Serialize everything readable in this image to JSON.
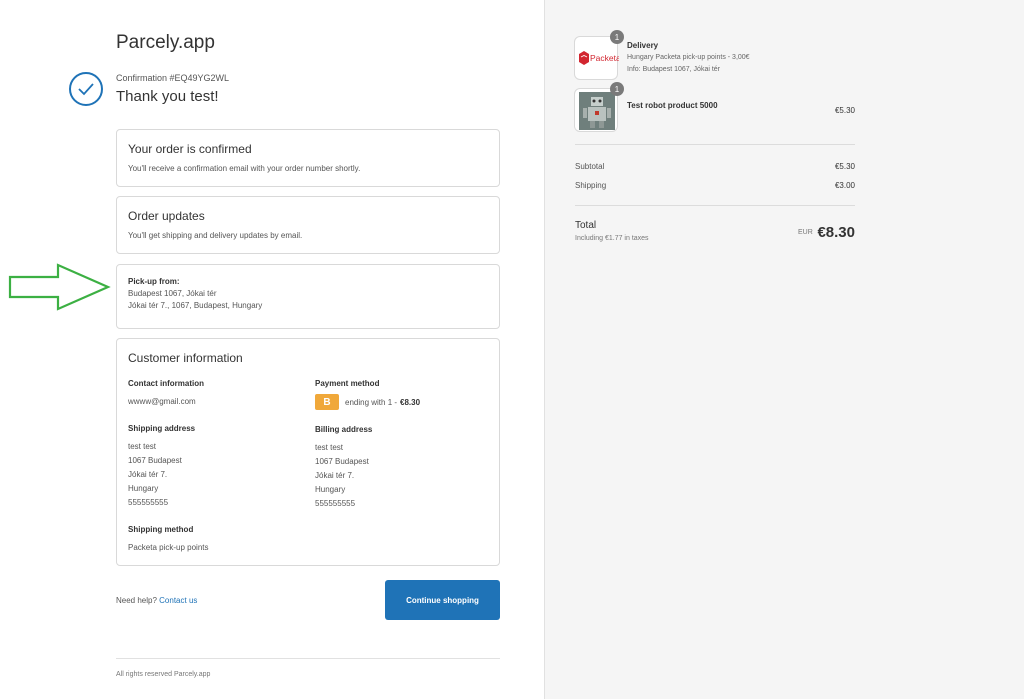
{
  "brand": "Parcely.app",
  "confirmation": {
    "number": "Confirmation #EQ49YG2WL",
    "thanks": "Thank you test!"
  },
  "order_confirmed": {
    "title": "Your order is confirmed",
    "text": "You'll receive a confirmation email with your order number shortly."
  },
  "order_updates": {
    "title": "Order updates",
    "text": "You'll get shipping and delivery updates by email."
  },
  "pickup": {
    "label": "Pick-up from:",
    "line1": "Budapest 1067, Jókai tér",
    "line2": "Jókai tér 7., 1067, Budapest, Hungary"
  },
  "customer": {
    "title": "Customer information",
    "contact_title": "Contact information",
    "contact_email": "wwww@gmail.com",
    "payment_title": "Payment method",
    "payment_badge": "B",
    "payment_text": "ending with 1 -",
    "payment_amount": "€8.30",
    "shipping_title": "Shipping address",
    "shipping_lines": [
      "test test",
      "1067 Budapest",
      "Jókai tér 7.",
      "Hungary",
      "555555555"
    ],
    "billing_title": "Billing address",
    "billing_lines": [
      "test test",
      "1067 Budapest",
      "Jókai tér 7.",
      "Hungary",
      "555555555"
    ],
    "method_title": "Shipping method",
    "method_text": "Packeta pick-up points"
  },
  "help": {
    "text": "Need help?",
    "link": "Contact us"
  },
  "continue_label": "Continue shopping",
  "footer": "All rights reserved Parcely.app",
  "summary": {
    "items": [
      {
        "qty": "1",
        "logo": "Packeta",
        "title": "Delivery",
        "sub1": "Hungary Packeta pick-up points - 3,00€",
        "sub2": "Info: Budapest 1067, Jókai tér",
        "price": ""
      },
      {
        "qty": "1",
        "title": "Test robot product 5000",
        "price": "€5.30"
      }
    ],
    "subtotal_label": "Subtotal",
    "subtotal_value": "€5.30",
    "shipping_label": "Shipping",
    "shipping_value": "€3.00",
    "total_label": "Total",
    "taxes": "Including €1.77 in taxes",
    "currency": "EUR",
    "total_value": "€8.30"
  },
  "colors": {
    "accent": "#1f73b7",
    "badge": "#f0a83a",
    "arrow": "#3cb043",
    "packeta": "#d22630"
  }
}
